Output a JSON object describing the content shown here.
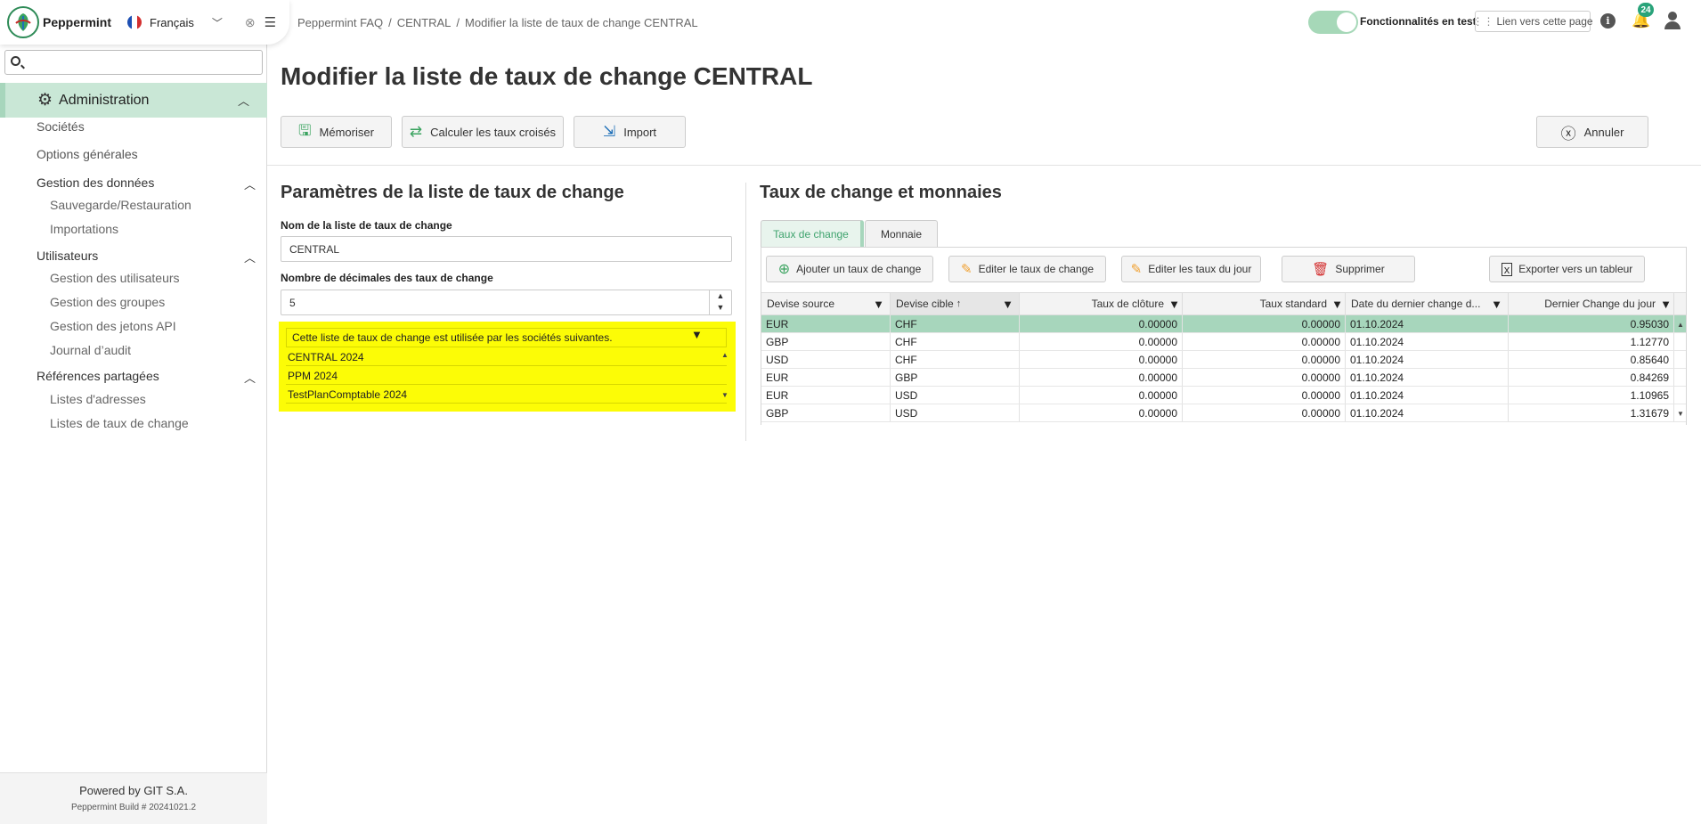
{
  "app": {
    "name": "Peppermint",
    "language": "Français",
    "footer_powered": "Powered by GIT S.A.",
    "footer_build": "Peppermint Build # 20241021.2"
  },
  "colors": {
    "accent": "#a7d6bc",
    "nav_active": "#c9e7d6",
    "highlight": "#fcfc06",
    "toggle_on": "#a6d8b8",
    "badge": "#29a37a"
  },
  "sidebar": {
    "search_placeholder": "",
    "section": "Administration",
    "items": [
      {
        "label": "Sociétés"
      },
      {
        "label": "Options générales"
      },
      {
        "label": "Gestion des données",
        "group": true
      },
      {
        "label": "Sauvegarde/Restauration"
      },
      {
        "label": "Importations"
      },
      {
        "label": "Utilisateurs",
        "group": true
      },
      {
        "label": "Gestion des utilisateurs"
      },
      {
        "label": "Gestion des groupes"
      },
      {
        "label": "Gestion des jetons API"
      },
      {
        "label": "Journal d’audit"
      },
      {
        "label": "Références partagées",
        "group": true
      },
      {
        "label": "Listes d'adresses"
      },
      {
        "label": "Listes de taux de change"
      }
    ]
  },
  "header": {
    "breadcrumb": [
      "Peppermint FAQ",
      "CENTRAL",
      "Modifier la liste de taux de change CENTRAL"
    ],
    "toggle_label": "Fonctionnalités en test",
    "toggle_on": true,
    "link_label": "Lien vers cette page",
    "notification_count": "24"
  },
  "page": {
    "title": "Modifier la liste de taux de change CENTRAL",
    "toolbar": {
      "save": "Mémoriser",
      "cross_rates": "Calculer les taux croisés",
      "import": "Import",
      "cancel": "Annuler"
    }
  },
  "params": {
    "title": "Paramètres de la liste de taux de change",
    "name_label": "Nom de la liste de taux de change",
    "name_value": "CENTRAL",
    "decimals_label": "Nombre de décimales des taux de change",
    "decimals_value": "5",
    "companies_header": "Cette liste de taux de change est utilisée par les sociétés suivantes.",
    "companies": [
      "CENTRAL 2024",
      "PPM 2024",
      "TestPlanComptable 2024"
    ]
  },
  "rates": {
    "title": "Taux de change et monnaies",
    "tabs": [
      "Taux de change",
      "Monnaie"
    ],
    "actions": {
      "add": "Ajouter un taux de change",
      "edit": "Editer le taux de change",
      "edit_day": "Editer les taux du jour",
      "delete": "Supprimer",
      "export": "Exporter vers un tableur"
    },
    "columns": [
      "Devise source",
      "Devise cible",
      "Taux de clôture",
      "Taux standard",
      "Date du dernier change d...",
      "Dernier Change du jour"
    ],
    "rows": [
      [
        "EUR",
        "CHF",
        "0.00000",
        "0.00000",
        "01.10.2024",
        "0.95030"
      ],
      [
        "GBP",
        "CHF",
        "0.00000",
        "0.00000",
        "01.10.2024",
        "1.12770"
      ],
      [
        "USD",
        "CHF",
        "0.00000",
        "0.00000",
        "01.10.2024",
        "0.85640"
      ],
      [
        "EUR",
        "GBP",
        "0.00000",
        "0.00000",
        "01.10.2024",
        "0.84269"
      ],
      [
        "EUR",
        "USD",
        "0.00000",
        "0.00000",
        "01.10.2024",
        "1.10965"
      ],
      [
        "GBP",
        "USD",
        "0.00000",
        "0.00000",
        "01.10.2024",
        "1.31679"
      ]
    ],
    "selected_row": 0
  }
}
